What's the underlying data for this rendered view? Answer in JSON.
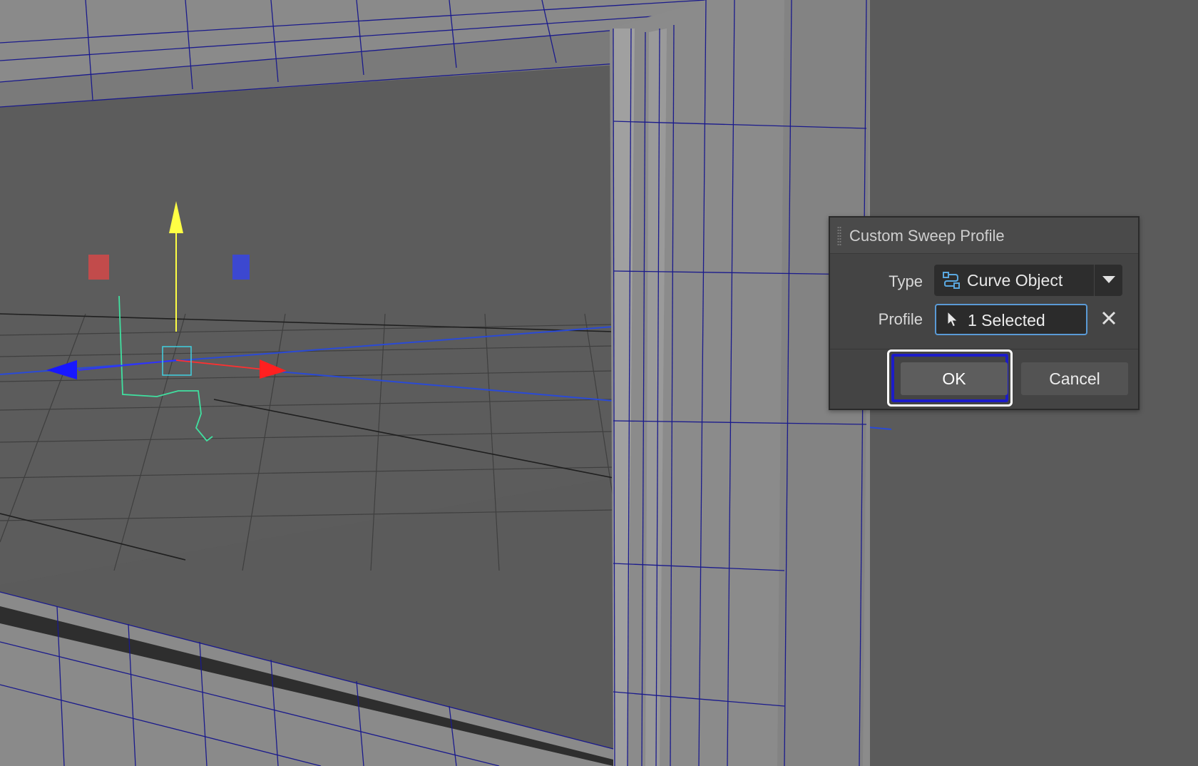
{
  "dialog": {
    "title": "Custom Sweep Profile",
    "type_label": "Type",
    "type_value": "Curve Object",
    "profile_label": "Profile",
    "profile_value": "1 Selected",
    "ok_label": "OK",
    "cancel_label": "Cancel"
  },
  "icons": {
    "grip": "drag-handle-icon",
    "type": "curve-object-icon",
    "dropdown": "chevron-down-icon",
    "profile": "cursor-arrow-icon",
    "clear": "close-icon"
  },
  "colors": {
    "viewport_bg": "#5a5a5a",
    "wireframe": "#1a1a8c",
    "gizmo_x": "#ff2020",
    "gizmo_y": "#ffff44",
    "gizmo_z": "#2020ff",
    "curve": "#40e0a0",
    "focus_outer": "#ffffff",
    "focus_inner": "#1c1cc8"
  }
}
